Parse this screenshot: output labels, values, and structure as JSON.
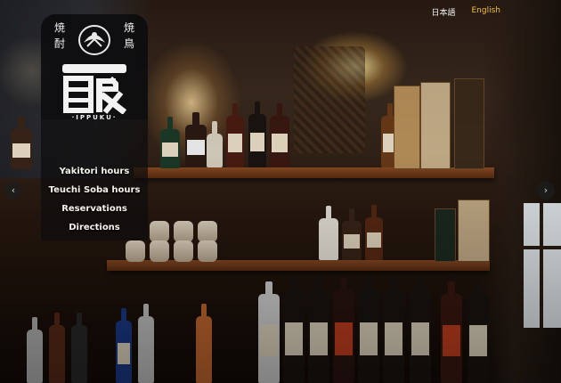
{
  "brand": {
    "kanji_left": "焼酎",
    "kanji_right": "焼鳥",
    "logo_text": "一服",
    "logo_reading": "·IPPUKU·"
  },
  "menu": {
    "items": [
      {
        "label": "Yakitori hours"
      },
      {
        "label": "Teuchi Soba hours"
      },
      {
        "label": "Reservations"
      },
      {
        "label": "Directions"
      }
    ]
  },
  "language": {
    "japanese": "日本語",
    "english": "English",
    "active": "English"
  },
  "slider": {
    "prev_icon": "chevron-left-icon",
    "next_icon": "chevron-right-icon",
    "prev_glyph": "‹",
    "next_glyph": "›"
  },
  "colors": {
    "accent": "#f0c030",
    "panel": "#0c0c0e",
    "text": "#f4f1ea"
  }
}
